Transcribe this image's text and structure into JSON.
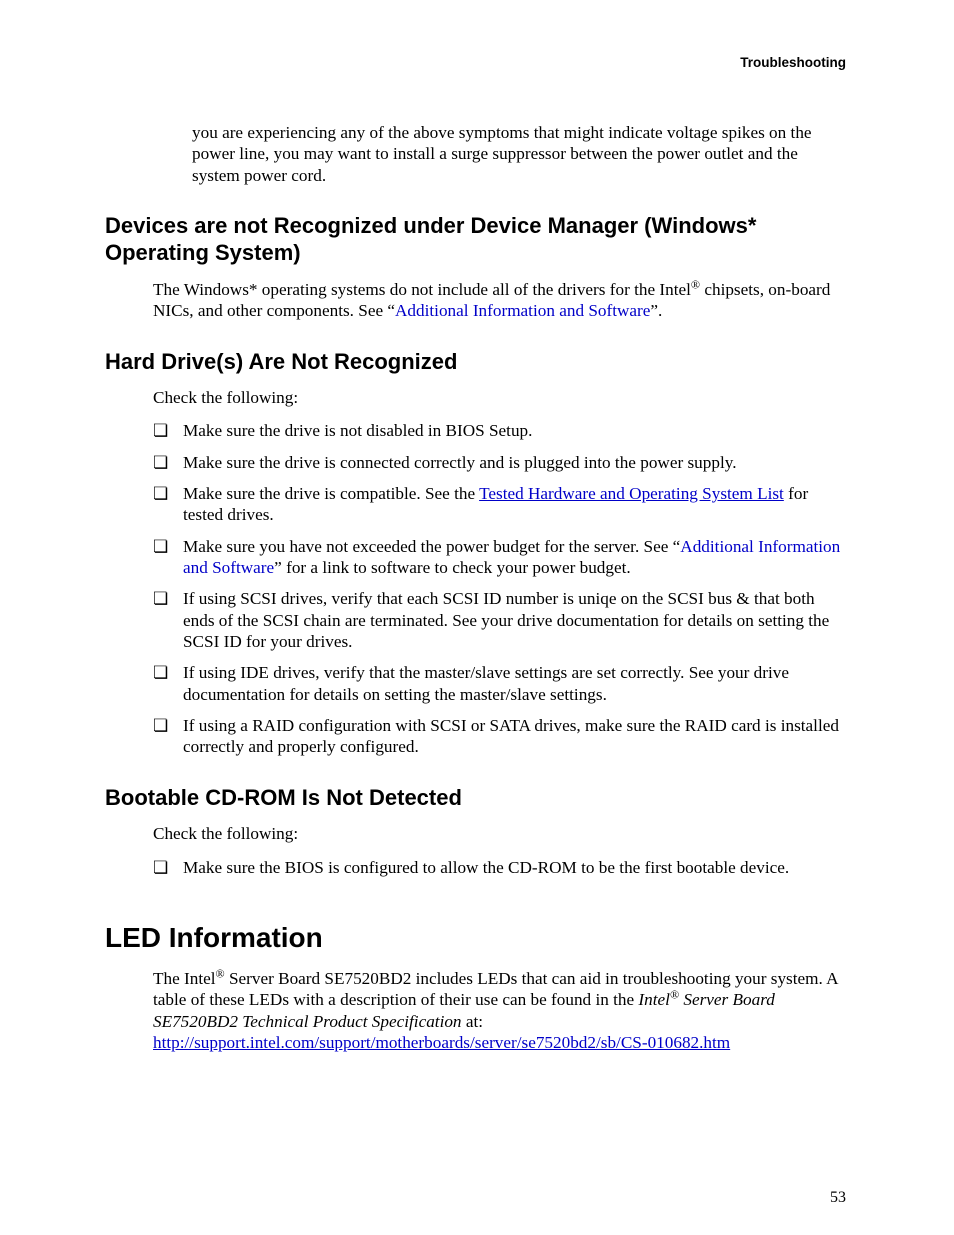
{
  "header": {
    "title": "Troubleshooting"
  },
  "footer": {
    "page_number": "53"
  },
  "intro_para": "you are experiencing any of the above symptoms that might indicate voltage spikes on the power line, you may want to install a surge suppressor between the power outlet and the system power cord.",
  "sec1": {
    "heading": "Devices are not Recognized under Device Manager (Windows* Operating System)",
    "para_pre": "The Windows* operating systems do not include all of the drivers for the Intel",
    "para_mid": " chipsets, on-board NICs, and other components. See “",
    "link": "Additional Information and Software",
    "para_post": "”."
  },
  "sec2": {
    "heading": "Hard Drive(s) Are Not Recognized",
    "para": "Check the following:",
    "items": {
      "i0": "Make sure the drive is not disabled in BIOS Setup.",
      "i1": "Make sure the drive is connected correctly and is plugged into the power supply.",
      "i2_pre": "Make sure the drive is compatible. See the ",
      "i2_link": "Tested Hardware and Operating System List",
      "i2_post": " for tested drives.",
      "i3_pre": "Make sure you have not exceeded the power budget for the server. See “",
      "i3_link": "Additional Information and Software",
      "i3_post": "” for a link to software to check your power budget.",
      "i4": "If using SCSI drives, verify that each SCSI ID number is uniqe on the SCSI bus & that both ends of the SCSI chain are terminated. See your drive documentation for details on setting the SCSI ID for your drives.",
      "i5": "If using IDE drives, verify that the master/slave settings are set correctly. See your drive documentation for details on setting the master/slave settings.",
      "i6": "If using a RAID configuration with SCSI or SATA drives, make sure the RAID card is installed correctly and properly configured."
    }
  },
  "sec3": {
    "heading": "Bootable CD-ROM Is Not Detected",
    "para": "Check the following:",
    "items": {
      "i0": "Make sure the BIOS is configured to allow the CD-ROM to be the first bootable device."
    }
  },
  "sec4": {
    "heading": "LED Information",
    "para_pre": "The Intel",
    "para_mid1": " Server Board SE7520BD2 includes LEDs that can aid in troubleshooting your system. A table of these LEDs with a description of their use can be found in the ",
    "para_em_pre": "Intel",
    "para_em_post": " Server Board SE7520BD2 Technical Product Specification",
    "para_mid2": " at:",
    "link": "http://support.intel.com/support/motherboards/server/se7520bd2/sb/CS-010682.htm"
  }
}
